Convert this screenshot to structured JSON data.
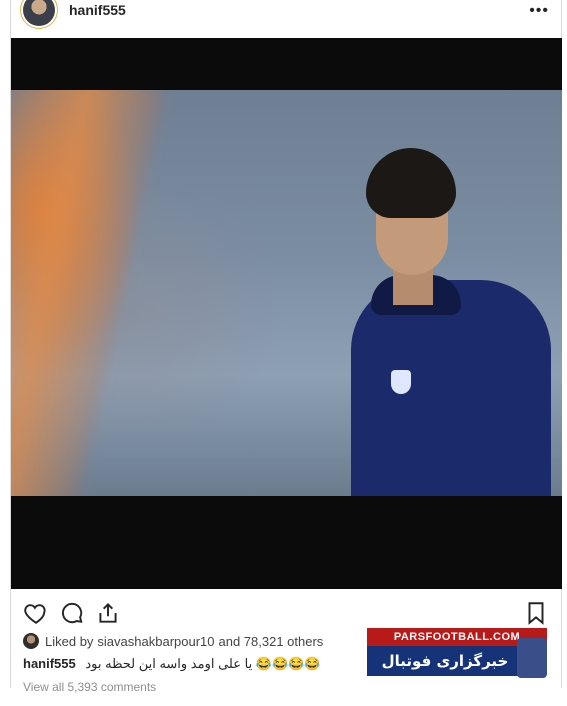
{
  "post": {
    "username": "hanif555",
    "more_label": "•••",
    "liked_prefix": "Liked by",
    "liked_user": "siavashakbarpour10",
    "liked_others": "and 78,321 others",
    "caption_user": "hanif555",
    "caption_text": "یا علی اومد واسه این لحظه بود 😂😂😂😂",
    "views_text": "View all 5,393 comments"
  },
  "watermark": {
    "top": "PARSFOOTBALL.COM",
    "bottom": "خبرگزاری فوتبال ایران"
  },
  "icons": [
    "heart-icon",
    "comment-icon",
    "share-icon",
    "bookmark-icon",
    "more-icon"
  ]
}
